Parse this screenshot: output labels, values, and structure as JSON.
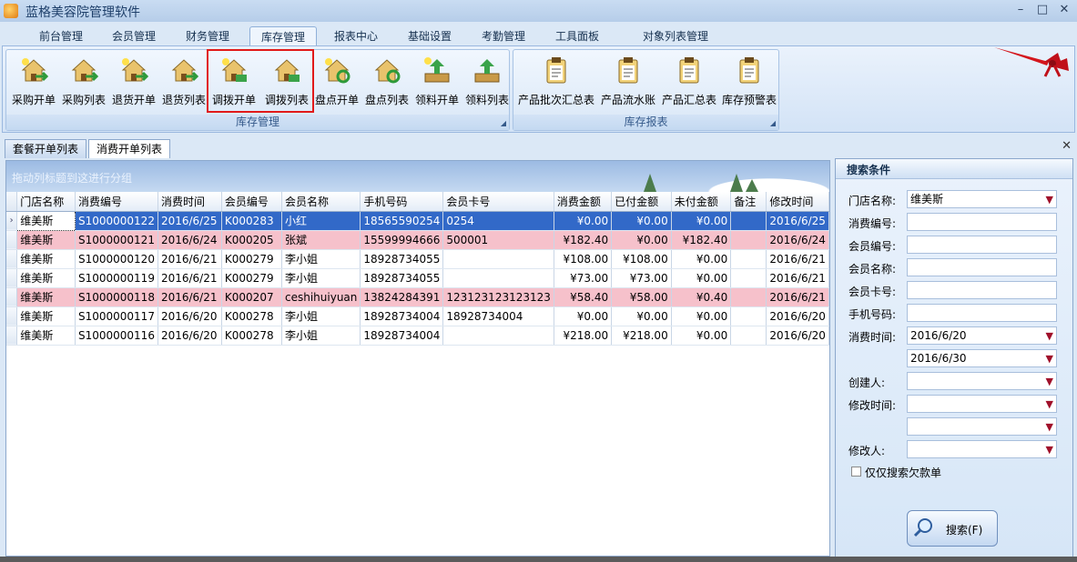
{
  "window": {
    "title": "蓝格美容院管理软件",
    "min": "–",
    "max": "□",
    "close": "✕"
  },
  "menu_tabs": [
    "前台管理",
    "会员管理",
    "财务管理",
    "库存管理",
    "报表中心",
    "基础设置",
    "考勤管理",
    "工具面板",
    "对象列表管理"
  ],
  "active_menu_tab": "库存管理",
  "ribbon": {
    "group1": {
      "label": "库存管理",
      "buttons": [
        "采购开单",
        "采购列表",
        "退货开单",
        "退货列表",
        "调拨开单",
        "调拨列表",
        "盘点开单",
        "盘点列表",
        "领料开单",
        "领料列表"
      ]
    },
    "group2": {
      "label": "库存报表",
      "buttons": [
        "产品批次汇总表",
        "产品流水账",
        "产品汇总表",
        "库存预警表"
      ]
    }
  },
  "doc_tabs": [
    "套餐开单列表",
    "消费开单列表"
  ],
  "active_doc_tab": "消费开单列表",
  "grid": {
    "group_hint": "拖动列标题到这进行分组",
    "columns": [
      "门店名称",
      "消费编号",
      "消费时间",
      "会员编号",
      "会员名称",
      "手机号码",
      "会员卡号",
      "消费金额",
      "已付金额",
      "未付金额",
      "备注",
      "修改时间"
    ],
    "rows": [
      {
        "store": "维美斯",
        "id": "S1000000122",
        "date": "2016/6/25",
        "member_no": "K000283",
        "member_name": "小红",
        "phone": "18565590254",
        "card": "0254",
        "amount": "¥0.00",
        "paid": "¥0.00",
        "unpaid": "¥0.00",
        "note": "",
        "modified": "2016/6/25",
        "state": "sel"
      },
      {
        "store": "维美斯",
        "id": "S1000000121",
        "date": "2016/6/24",
        "member_no": "K000205",
        "member_name": "张斌",
        "phone": "15599994666",
        "card": "500001",
        "amount": "¥182.40",
        "paid": "¥0.00",
        "unpaid": "¥182.40",
        "note": "",
        "modified": "2016/6/24",
        "state": "pink"
      },
      {
        "store": "维美斯",
        "id": "S1000000120",
        "date": "2016/6/21",
        "member_no": "K000279",
        "member_name": "李小姐",
        "phone": "18928734055",
        "card": "",
        "amount": "¥108.00",
        "paid": "¥108.00",
        "unpaid": "¥0.00",
        "note": "",
        "modified": "2016/6/21",
        "state": ""
      },
      {
        "store": "维美斯",
        "id": "S1000000119",
        "date": "2016/6/21",
        "member_no": "K000279",
        "member_name": "李小姐",
        "phone": "18928734055",
        "card": "",
        "amount": "¥73.00",
        "paid": "¥73.00",
        "unpaid": "¥0.00",
        "note": "",
        "modified": "2016/6/21",
        "state": ""
      },
      {
        "store": "维美斯",
        "id": "S1000000118",
        "date": "2016/6/21",
        "member_no": "K000207",
        "member_name": "ceshihuiyuan",
        "phone": "13824284391",
        "card": "123123123123123",
        "amount": "¥58.40",
        "paid": "¥58.00",
        "unpaid": "¥0.40",
        "note": "",
        "modified": "2016/6/21",
        "state": "pink"
      },
      {
        "store": "维美斯",
        "id": "S1000000117",
        "date": "2016/6/20",
        "member_no": "K000278",
        "member_name": "李小姐",
        "phone": "18928734004",
        "card": "18928734004",
        "amount": "¥0.00",
        "paid": "¥0.00",
        "unpaid": "¥0.00",
        "note": "",
        "modified": "2016/6/20",
        "state": ""
      },
      {
        "store": "维美斯",
        "id": "S1000000116",
        "date": "2016/6/20",
        "member_no": "K000278",
        "member_name": "李小姐",
        "phone": "18928734004",
        "card": "",
        "amount": "¥218.00",
        "paid": "¥218.00",
        "unpaid": "¥0.00",
        "note": "",
        "modified": "2016/6/20",
        "state": ""
      }
    ]
  },
  "search": {
    "title": "搜索条件",
    "store_label": "门店名称:",
    "store_value": "维美斯",
    "id_label": "消费编号:",
    "member_no_label": "会员编号:",
    "member_name_label": "会员名称:",
    "card_label": "会员卡号:",
    "phone_label": "手机号码:",
    "date_label": "消费时间:",
    "date_from": "2016/6/20",
    "date_to": "2016/6/30",
    "creator_label": "创建人:",
    "modified_label": "修改时间:",
    "modifier_label": "修改人:",
    "debt_only_label": "仅仅搜索欠款单",
    "search_button": "搜索(F)"
  },
  "colors": {
    "accent": "#3269c8",
    "highlight_row": "#f6c1cb",
    "annotation_box": "#e11a1a"
  }
}
